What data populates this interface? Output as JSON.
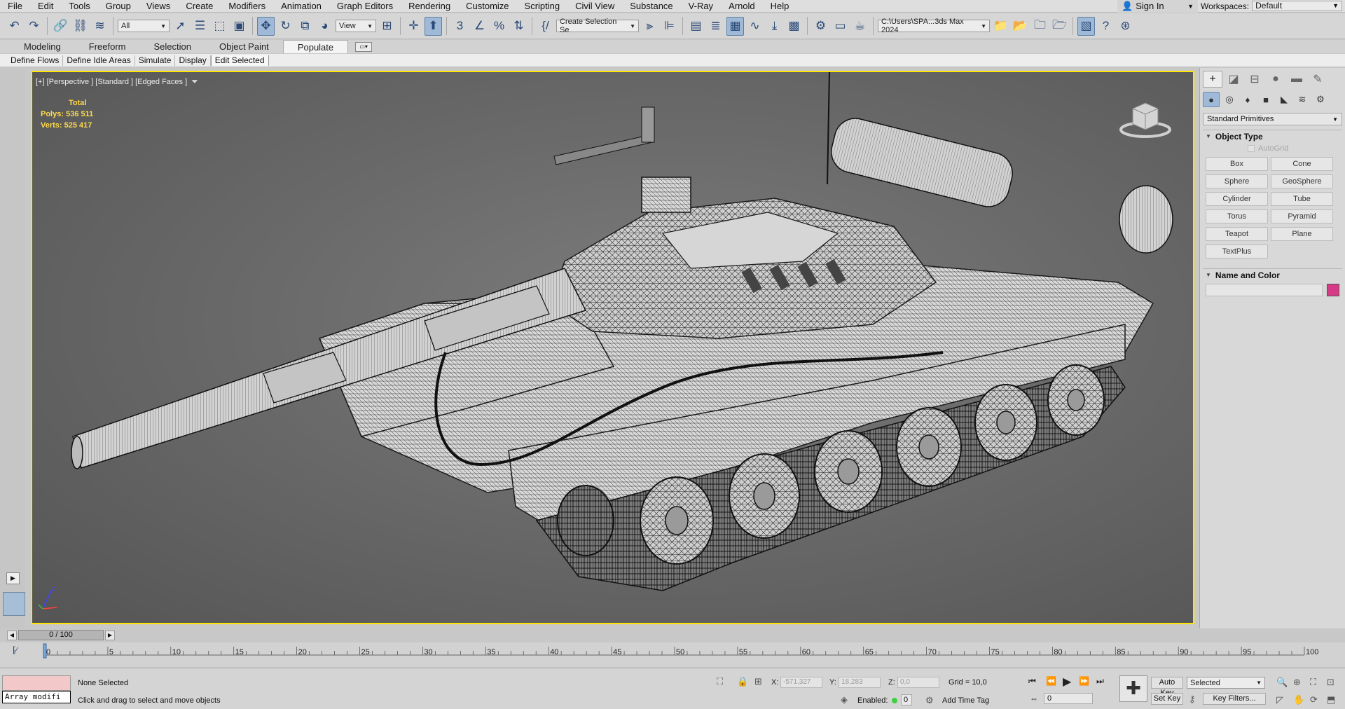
{
  "menu": [
    "File",
    "Edit",
    "Tools",
    "Group",
    "Views",
    "Create",
    "Modifiers",
    "Animation",
    "Graph Editors",
    "Rendering",
    "Customize",
    "Scripting",
    "Civil View",
    "Substance",
    "V-Ray",
    "Arnold",
    "Help"
  ],
  "signin": {
    "label": "Sign In"
  },
  "workspaces": {
    "label": "Workspaces:",
    "value": "Default"
  },
  "toolbar": {
    "filter_select": "All",
    "refcoord_select": "View",
    "selection_set": "Create Selection Se",
    "project_path": "C:\\Users\\SPA...3ds Max 2024"
  },
  "ribbon": {
    "tabs": [
      "Modeling",
      "Freeform",
      "Selection",
      "Object Paint",
      "Populate"
    ],
    "active_tab": "Populate"
  },
  "subtabs": [
    "Define Flows",
    "Define Idle Areas",
    "Simulate",
    "Display",
    "Edit Selected"
  ],
  "viewport": {
    "label": "[+] [Perspective ] [Standard ] [Edged Faces ]",
    "stats": {
      "total_label": "Total",
      "polys_label": "Polys:",
      "polys": "536 511",
      "verts_label": "Verts:",
      "verts": "525 417"
    },
    "accent": "#ffe600",
    "stats_color": "#ffd84a"
  },
  "command_panel": {
    "category_dropdown": "Standard Primitives",
    "object_type_title": "Object Type",
    "autogrid_label": "AutoGrid",
    "object_buttons": [
      "Box",
      "Cone",
      "Sphere",
      "GeoSphere",
      "Cylinder",
      "Tube",
      "Torus",
      "Pyramid",
      "Teapot",
      "Plane",
      "TextPlus"
    ],
    "name_color_title": "Name and Color",
    "swatch_color": "#d63a86"
  },
  "timeline": {
    "frame_display": "0 / 100",
    "ticks": [
      "0",
      "5",
      "10",
      "15",
      "20",
      "25",
      "30",
      "35",
      "40",
      "45",
      "50",
      "55",
      "60",
      "65",
      "70",
      "75",
      "80",
      "85",
      "90",
      "95",
      "100"
    ]
  },
  "status": {
    "selection": "None Selected",
    "prompt": "Click and drag to select and move objects",
    "listener_input": "Array modifi",
    "x_label": "X:",
    "x_value": "-571,327",
    "y_label": "Y:",
    "y_value": "18,283",
    "z_label": "Z:",
    "z_value": "0,0",
    "grid": "Grid = 10,0",
    "enabled_label": "Enabled:",
    "enabled_value": "0",
    "add_time_tag": "Add Time Tag",
    "auto_key": "Auto Key",
    "selected_dropdown": "Selected",
    "set_key": "Set Key",
    "key_filters": "Key Filters...",
    "frame_field": "0"
  }
}
